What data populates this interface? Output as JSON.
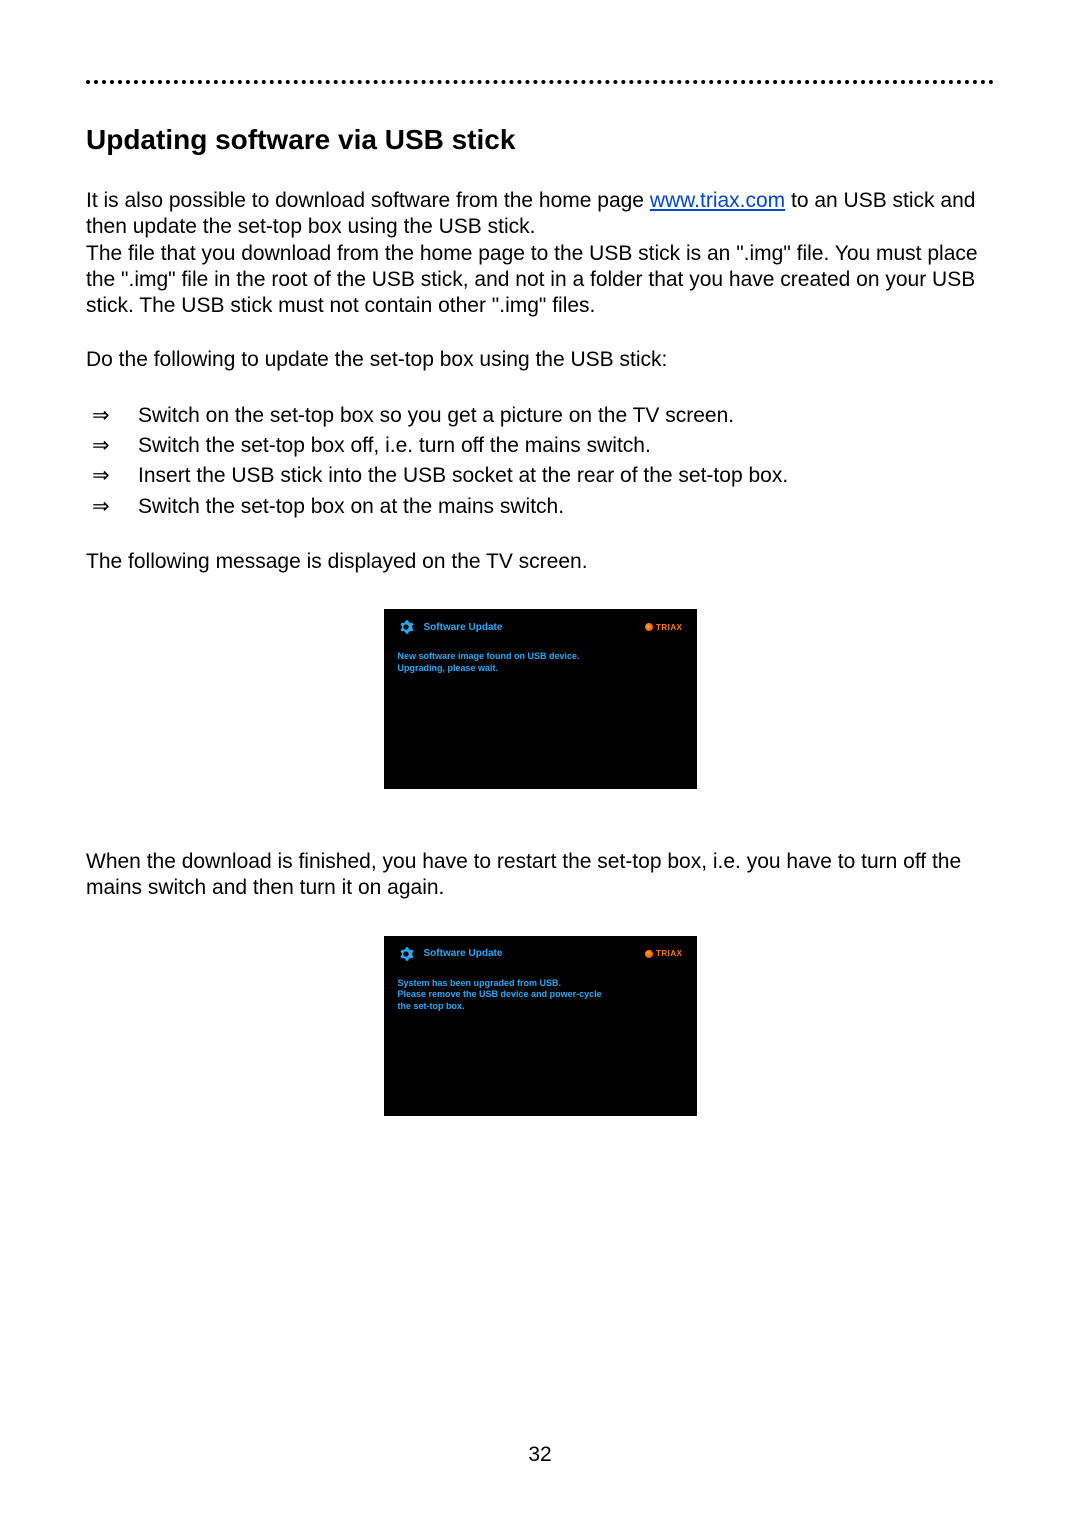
{
  "heading": "Updating software via USB stick",
  "intro": {
    "part1": "It is also possible to download software from the home page ",
    "link_text": "www.triax.com",
    "part2": " to an USB stick and then update the set-top box using the USB stick.",
    "sentence2": "The file that you download from the home page to the USB stick is an \".img\" file. You must place the \".img\" file in the root of the USB stick, and not in a folder that you have created on your USB stick. The USB stick must not contain other \".img\" files."
  },
  "do_following": "Do the following to update the set-top box using the USB stick:",
  "arrow_glyph": "⇒",
  "steps": [
    "Switch on the set-top box so you get a picture on the TV screen.",
    "Switch the set-top box off, i.e. turn off the mains switch.",
    "Insert the USB stick into the USB socket at the rear of the set-top box.",
    "Switch the set-top box on at the mains switch."
  ],
  "following_msg": "The following message is displayed on the TV screen.",
  "screenshot1": {
    "title": "Software Update",
    "brand": "TRIAX",
    "line1": "New software image found on USB device.",
    "line2": "Upgrading, please wait."
  },
  "after_download": "When the download is finished, you have to restart the set-top box, i.e. you have to turn off the mains switch and then turn it on again.",
  "screenshot2": {
    "title": "Software Update",
    "brand": "TRIAX",
    "line1": "System has been upgraded from USB.",
    "line2": "Please remove the USB device and power-cycle",
    "line3": "the set-top box."
  },
  "page_number": "32"
}
